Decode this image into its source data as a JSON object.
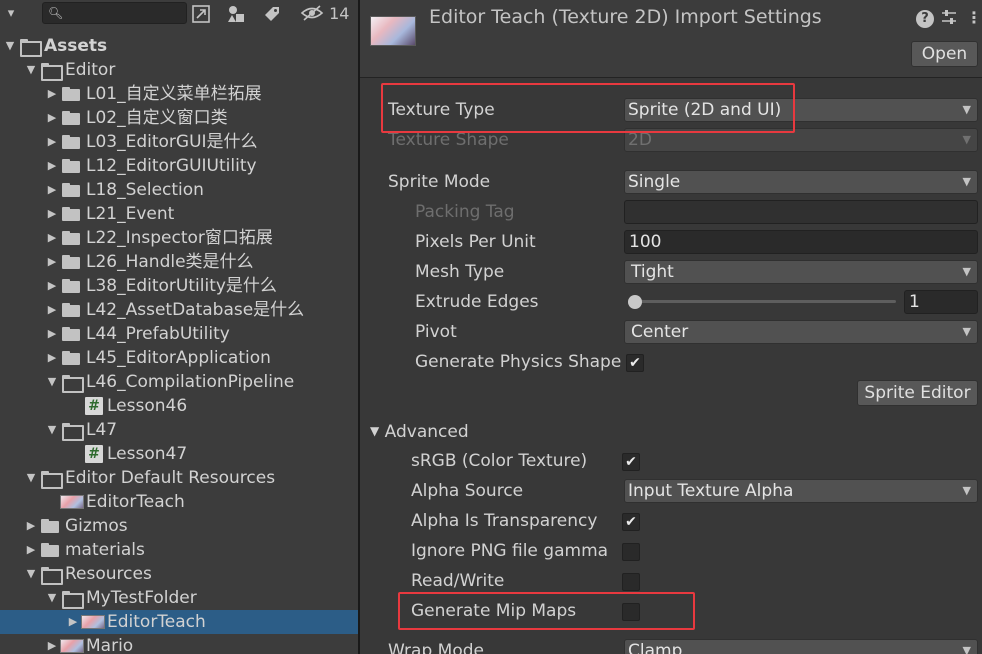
{
  "project": {
    "search_placeholder": "",
    "hidden_count": "14",
    "tree": [
      {
        "label": "Assets",
        "kind": "folder-open",
        "depth": 0,
        "arrow": "down",
        "bold": true
      },
      {
        "label": "Editor",
        "kind": "folder-open",
        "depth": 1,
        "arrow": "down"
      },
      {
        "label": "L01_自定义菜单栏拓展",
        "kind": "folder",
        "depth": 2,
        "arrow": "right"
      },
      {
        "label": "L02_自定义窗口类",
        "kind": "folder",
        "depth": 2,
        "arrow": "right"
      },
      {
        "label": "L03_EditorGUI是什么",
        "kind": "folder",
        "depth": 2,
        "arrow": "right"
      },
      {
        "label": "L12_EditorGUIUtility",
        "kind": "folder",
        "depth": 2,
        "arrow": "right"
      },
      {
        "label": "L18_Selection",
        "kind": "folder",
        "depth": 2,
        "arrow": "right"
      },
      {
        "label": "L21_Event",
        "kind": "folder",
        "depth": 2,
        "arrow": "right"
      },
      {
        "label": "L22_Inspector窗口拓展",
        "kind": "folder",
        "depth": 2,
        "arrow": "right"
      },
      {
        "label": "L26_Handle类是什么",
        "kind": "folder",
        "depth": 2,
        "arrow": "right"
      },
      {
        "label": "L38_EditorUtility是什么",
        "kind": "folder",
        "depth": 2,
        "arrow": "right"
      },
      {
        "label": "L42_AssetDatabase是什么",
        "kind": "folder",
        "depth": 2,
        "arrow": "right"
      },
      {
        "label": "L44_PrefabUtility",
        "kind": "folder",
        "depth": 2,
        "arrow": "right"
      },
      {
        "label": "L45_EditorApplication",
        "kind": "folder",
        "depth": 2,
        "arrow": "right"
      },
      {
        "label": "L46_CompilationPipeline",
        "kind": "folder-open",
        "depth": 2,
        "arrow": "down"
      },
      {
        "label": "Lesson46",
        "kind": "script",
        "depth": 3,
        "arrow": ""
      },
      {
        "label": "L47",
        "kind": "folder-open",
        "depth": 2,
        "arrow": "down"
      },
      {
        "label": "Lesson47",
        "kind": "script",
        "depth": 3,
        "arrow": ""
      },
      {
        "label": "Editor Default Resources",
        "kind": "folder-open",
        "depth": 1,
        "arrow": "down"
      },
      {
        "label": "EditorTeach",
        "kind": "image",
        "depth": 2,
        "arrow": ""
      },
      {
        "label": "Gizmos",
        "kind": "folder",
        "depth": 1,
        "arrow": "right"
      },
      {
        "label": "materials",
        "kind": "folder",
        "depth": 1,
        "arrow": "right"
      },
      {
        "label": "Resources",
        "kind": "folder-open",
        "depth": 1,
        "arrow": "down"
      },
      {
        "label": "MyTestFolder",
        "kind": "folder-open",
        "depth": 2,
        "arrow": "down"
      },
      {
        "label": "EditorTeach",
        "kind": "image",
        "depth": 3,
        "arrow": "right",
        "selected": true
      },
      {
        "label": "Mario",
        "kind": "image",
        "depth": 2,
        "arrow": "right"
      }
    ]
  },
  "inspector": {
    "title": "Editor Teach (Texture 2D) Import Settings",
    "open_button": "Open",
    "texture_type": {
      "label": "Texture Type",
      "value": "Sprite (2D and UI)"
    },
    "texture_shape": {
      "label": "Texture Shape",
      "value": "2D"
    },
    "sprite_mode": {
      "label": "Sprite Mode",
      "value": "Single"
    },
    "packing_tag": {
      "label": "Packing Tag",
      "value": ""
    },
    "pixels_per_unit": {
      "label": "Pixels Per Unit",
      "value": "100"
    },
    "mesh_type": {
      "label": "Mesh Type",
      "value": "Tight"
    },
    "extrude_edges": {
      "label": "Extrude Edges",
      "value": "1",
      "level": 0.0
    },
    "pivot": {
      "label": "Pivot",
      "value": "Center"
    },
    "generate_physics_shape": {
      "label": "Generate Physics Shape",
      "checked": true
    },
    "sprite_editor_button": "Sprite Editor",
    "advanced": {
      "label": "Advanced"
    },
    "srgb": {
      "label": "sRGB (Color Texture)",
      "checked": true
    },
    "alpha_source": {
      "label": "Alpha Source",
      "value": "Input Texture Alpha"
    },
    "alpha_is_transparency": {
      "label": "Alpha Is Transparency",
      "checked": true
    },
    "ignore_png_gamma": {
      "label": "Ignore PNG file gamma",
      "checked": false
    },
    "read_write": {
      "label": "Read/Write",
      "checked": false
    },
    "generate_mip_maps": {
      "label": "Generate Mip Maps",
      "checked": false
    },
    "wrap_mode": {
      "label": "Wrap Mode",
      "value": "Clamp"
    }
  },
  "colors": {
    "highlight": "#e8393f",
    "selection": "#2c5d87"
  },
  "icons": [
    "search-icon",
    "scene-filter-icon",
    "type-filter-icon",
    "label-icon",
    "hidden-eye-icon",
    "help-icon",
    "presets-icon",
    "more-icon"
  ]
}
